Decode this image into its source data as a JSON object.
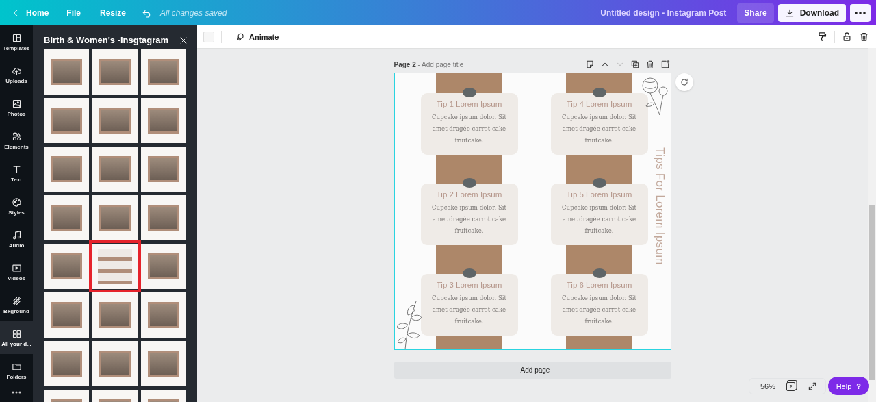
{
  "topbar": {
    "back_label": "Home",
    "menu": [
      "File",
      "Resize"
    ],
    "save_status": "All changes saved",
    "design_title": "Untitled design - Instagram Post",
    "share": "Share",
    "download": "Download"
  },
  "sidebar": {
    "items": [
      {
        "label": "Templates",
        "kind": "templates",
        "selected": false
      },
      {
        "label": "Uploads",
        "kind": "uploads",
        "selected": false
      },
      {
        "label": "Photos",
        "kind": "photos",
        "selected": false
      },
      {
        "label": "Elements",
        "kind": "elements",
        "selected": false
      },
      {
        "label": "Text",
        "kind": "text",
        "selected": false
      },
      {
        "label": "Styles",
        "kind": "styles",
        "selected": false
      },
      {
        "label": "Audio",
        "kind": "audio",
        "selected": false
      },
      {
        "label": "Videos",
        "kind": "videos",
        "selected": false
      },
      {
        "label": "Bkground",
        "kind": "background",
        "selected": false
      },
      {
        "label": "All your d...",
        "kind": "designs",
        "selected": true
      },
      {
        "label": "Folders",
        "kind": "folders",
        "selected": false
      }
    ]
  },
  "panel": {
    "title": "Birth & Women's -Insgtagram",
    "templates": [
      {
        "selected": false
      },
      {
        "selected": false
      },
      {
        "selected": false
      },
      {
        "selected": false
      },
      {
        "selected": false
      },
      {
        "selected": false
      },
      {
        "selected": false
      },
      {
        "selected": false
      },
      {
        "selected": false
      },
      {
        "selected": false
      },
      {
        "selected": false
      },
      {
        "selected": false
      },
      {
        "selected": false
      },
      {
        "selected": true
      },
      {
        "selected": false
      },
      {
        "selected": false
      },
      {
        "selected": false
      },
      {
        "selected": false
      },
      {
        "selected": false
      },
      {
        "selected": false
      },
      {
        "selected": false
      },
      {
        "selected": false
      },
      {
        "selected": false
      },
      {
        "selected": false
      }
    ]
  },
  "toolbar": {
    "animate": "Animate"
  },
  "page": {
    "title": "**Page 2** - Add page title",
    "actions": [
      {
        "kind": "note",
        "disabled": false
      },
      {
        "kind": "up",
        "disabled": false
      },
      {
        "kind": "down",
        "disabled": true
      },
      {
        "kind": "duplicate",
        "disabled": false
      },
      {
        "kind": "delete",
        "disabled": false
      },
      {
        "kind": "add",
        "disabled": false
      }
    ],
    "tips": [
      {
        "title": "Tip 1 Lorem Ipsum",
        "body": "Cupcake ipsum dolor. Sit amet dragée carrot cake fruitcake."
      },
      {
        "title": "Tip 2 Lorem Ipsum",
        "body": "Cupcake ipsum dolor. Sit amet dragée carrot cake fruitcake."
      },
      {
        "title": "Tip 3 Lorem Ipsum",
        "body": "Cupcake ipsum dolor. Sit amet dragée carrot cake fruitcake."
      },
      {
        "title": "Tip 4 Lorem Ipsum",
        "body": "Cupcake ipsum dolor. Sit amet dragée carrot cake fruitcake."
      },
      {
        "title": "Tip 5 Lorem Ipsum",
        "body": "Cupcake ipsum dolor. Sit amet dragée carrot cake fruitcake."
      },
      {
        "title": "Tip 6 Lorem Ipsum",
        "body": "Cupcake ipsum dolor. Sit amet dragée carrot cake fruitcake."
      }
    ],
    "side_title": "Tips For Lorem Ipsum",
    "add_page": "+ Add page"
  },
  "zoom": {
    "value": "56%",
    "pages": "2"
  },
  "help": {
    "label": "Help",
    "mark": "?"
  }
}
